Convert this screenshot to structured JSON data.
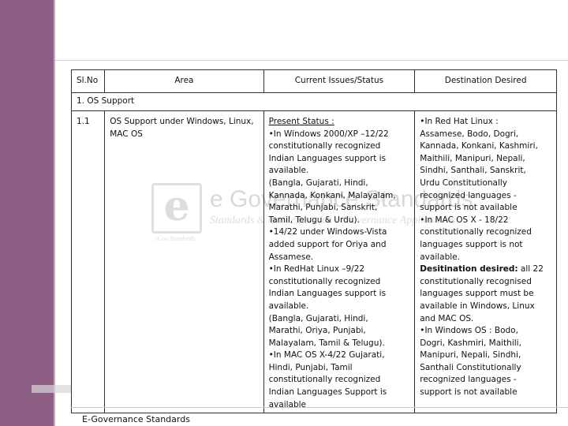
{
  "watermark": {
    "letter": "e",
    "title": "e Governance Standards",
    "subtitle": "Standards & Guidelines for e-Governance Applications",
    "small": "eGov Standards"
  },
  "table": {
    "headers": [
      "Sl.No",
      "Area",
      "Current Issues/Status",
      "Destination Desired"
    ],
    "section": "1.  OS Support",
    "row": {
      "num": "1.1",
      "area": "OS Support under  Windows, Linux, MAC OS",
      "current_heading": "Present Status :",
      "current_lines": [
        "•In Windows 2000/XP –12/22",
        "constitutionally recognized",
        "Indian Languages support is",
        "available.",
        "(Bangla, Gujarati, Hindi,",
        "Kannada, Konkani, Malayalam,",
        "Marathi, Punjabi, Sanskrit,",
        "Tamil, Telugu & Urdu).",
        "•14/22 under Windows-Vista",
        "added support for Oriya and",
        "Assamese.",
        "•In RedHat Linux –9/22",
        "constitutionally recognized",
        "Indian Languages support is",
        "available.",
        "(Bangla, Gujarati, Hindi,",
        "Marathi, Oriya, Punjabi,",
        "Malayalam, Tamil & Telugu).",
        "•In MAC OS X-4/22 Gujarati,",
        "Hindi, Punjabi, Tamil",
        "constitutionally recognized",
        "Indian Languages Support  is",
        "available"
      ],
      "dest_lines_a": [
        "•In Red Hat Linux :",
        "Assamese, Bodo, Dogri,",
        "Kannada, Konkani, Kashmiri,",
        "Maithili, Manipuri, Nepali,",
        "Sindhi, Santhali, Sanskrit,",
        "Urdu Constitutionally",
        "recognized  languages -",
        "support  is not available",
        "•In MAC OS X - 18/22",
        "constitutionally recognized",
        "languages support is not",
        "available."
      ],
      "dest_label": "Desitination desired:",
      "dest_label_rest": " all 22",
      "dest_lines_b": [
        "constitutionally recognised",
        "languages support must be",
        "available in Windows, Linux",
        "and MAC OS.",
        "•In Windows OS : Bodo,",
        "Dogri, Kashmiri, Maithili,",
        "Manipuri, Nepali, Sindhi,",
        "Santhali Constitutionally",
        "recognized  languages -",
        "support is not available"
      ]
    }
  },
  "footer": "E-Governance Standards"
}
